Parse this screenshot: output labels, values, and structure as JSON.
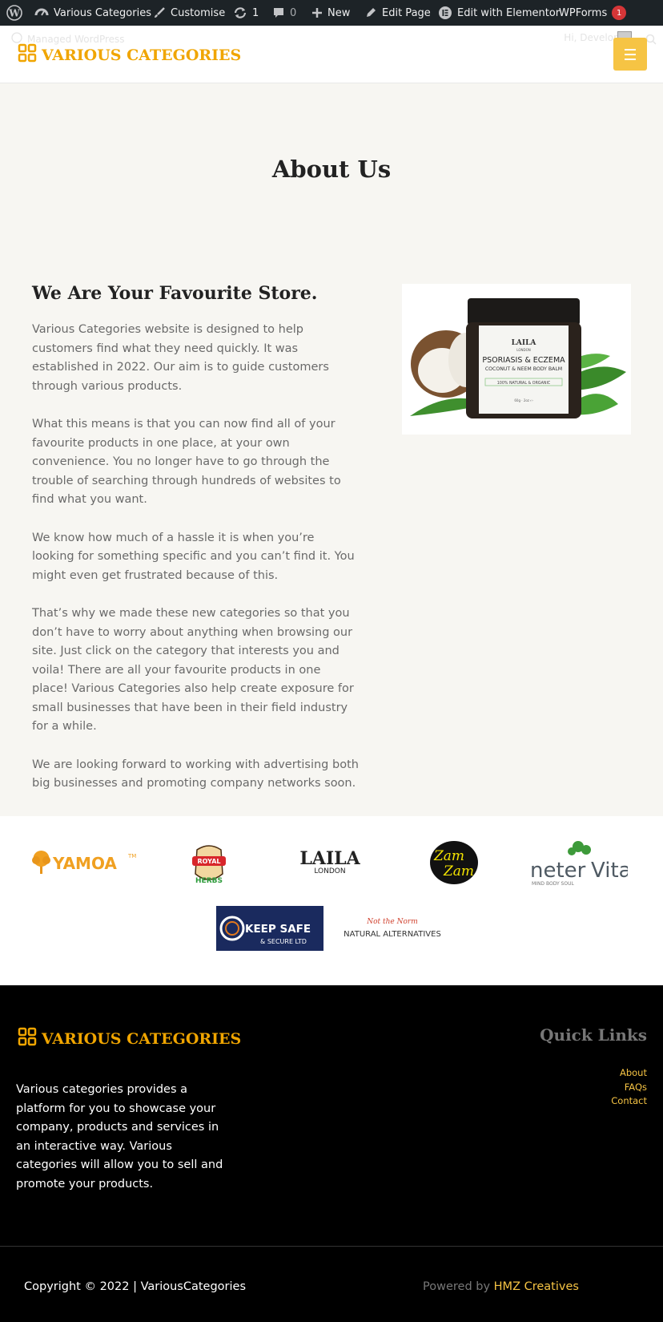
{
  "admin_bar": {
    "site_name": "Various Categories",
    "customise": "Customise",
    "updates_count": "1",
    "comments_count": "0",
    "new": "New",
    "edit_page": "Edit Page",
    "elementor": "Edit with Elementor",
    "wpforms": "WPForms",
    "wpforms_badge": "1"
  },
  "header": {
    "managed": "Managed WordPress",
    "greeting": "Hi, Developer",
    "logo_text": "VARIOUS CATEGORIES"
  },
  "page": {
    "title": "About Us",
    "heading": "We Are Your Favourite Store.",
    "paragraphs": [
      "Various Categories website is designed to help customers find what they need quickly. It was established in 2022. Our aim is to guide customers through various products.",
      "What this means is that you can now find all of your favourite products in one place, at your own convenience. You no longer have to go through the trouble of searching through hundreds of websites to find what you want.",
      "We know how much of a hassle it is when you’re looking for something specific and you can’t find it. You might even get frustrated because of this.",
      "That’s why we made these new categories so that you don’t have to worry about anything when browsing our site. Just click on the category that interests you and voila! There are all your favourite products in one place! Various Categories also help create exposure for small businesses that have been in their field industry for a while.",
      "We are looking forward to working with advertising both big businesses and promoting company networks soon."
    ],
    "product": {
      "brand": "LAILA",
      "brand_sub": "LONDON",
      "name": "PSORIASIS & ECZEMA",
      "subtitle": "COCONUT & NEEM BODY BALM",
      "tag": "100% NATURAL & ORGANIC",
      "weight": "60g · 2oz ℮"
    }
  },
  "brands": {
    "yamoa": "YAMOA",
    "yamoa_tm": "TM",
    "royal_line1": "ROYAL",
    "royal_line2": "HERBS",
    "laila": "LAILA",
    "laila_sub": "LONDON",
    "zamzam_1": "Zam",
    "zamzam_2": "Zam",
    "neter_a": "neter",
    "neter_b": "Vital",
    "neter_sub": "MIND BODY SOUL",
    "keepsafe_1": "KEEP SAFE",
    "keepsafe_2": "& SECURE LTD",
    "natural_script": "Not the Norm",
    "natural": "NATURAL ALTERNATIVES"
  },
  "footer": {
    "logo_text": "VARIOUS CATEGORIES",
    "description": "Various categories provides a platform for you to showcase your company, products and services in an interactive way. Various categories will allow you to sell and promote your products.",
    "quick_links_title": "Quick Links",
    "links": [
      "About",
      "FAQs",
      "Contact"
    ],
    "copyright": "Copyright © 2022 | VariousCategories",
    "powered_by": "Powered by",
    "powered_name": "HMZ Creatives"
  },
  "colors": {
    "accent": "#f0a500",
    "menu_button": "#f6c444",
    "admin_bar": "#1d2327",
    "content_bg": "#f7f6f2",
    "footer_bg": "#000000"
  }
}
